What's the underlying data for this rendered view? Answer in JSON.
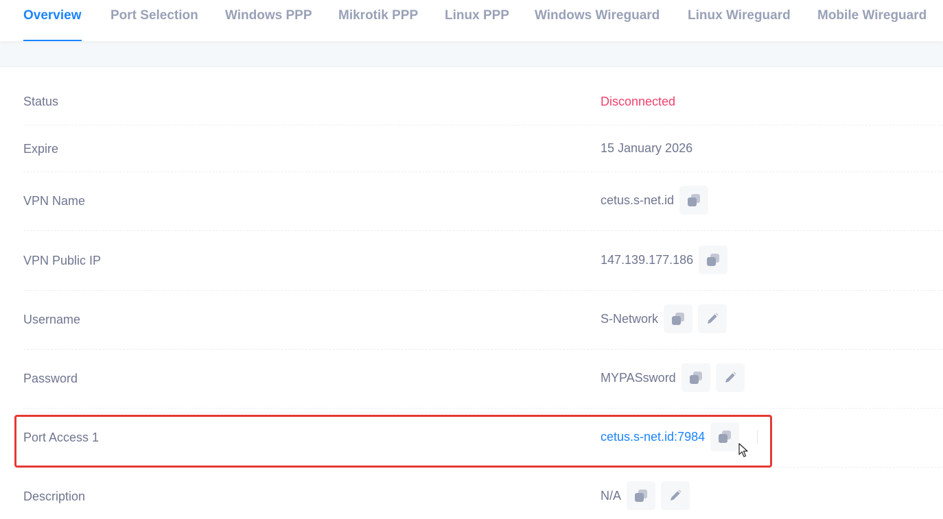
{
  "tabs": [
    {
      "label": "Overview",
      "active": true
    },
    {
      "label": "Port Selection",
      "active": false
    },
    {
      "label": "Windows PPP",
      "active": false
    },
    {
      "label": "Mikrotik PPP",
      "active": false
    },
    {
      "label": "Linux PPP",
      "active": false
    },
    {
      "label": "Windows Wireguard",
      "active": false
    },
    {
      "label": "Linux Wireguard",
      "active": false
    },
    {
      "label": "Mobile Wireguard",
      "active": false
    }
  ],
  "details": {
    "status": {
      "label": "Status",
      "value": "Disconnected"
    },
    "expire": {
      "label": "Expire",
      "value": "15 January 2026"
    },
    "vpn_name": {
      "label": "VPN Name",
      "value": "cetus.s-net.id"
    },
    "vpn_public_ip": {
      "label": "VPN Public IP",
      "value": "147.139.177.186"
    },
    "username": {
      "label": "Username",
      "value": "S-Network"
    },
    "password": {
      "label": "Password",
      "value": "MYPASsword"
    },
    "port_access_1": {
      "label": "Port Access 1",
      "value": "cetus.s-net.id:7984"
    },
    "description": {
      "label": "Description",
      "value": "N/A"
    }
  },
  "icons": {
    "copy": "copy-icon",
    "edit": "pencil-icon",
    "cursor": "mouse-pointer"
  },
  "colors": {
    "accent": "#1b84ff",
    "status_disconnected": "#f1416c",
    "highlight": "#e53935"
  }
}
